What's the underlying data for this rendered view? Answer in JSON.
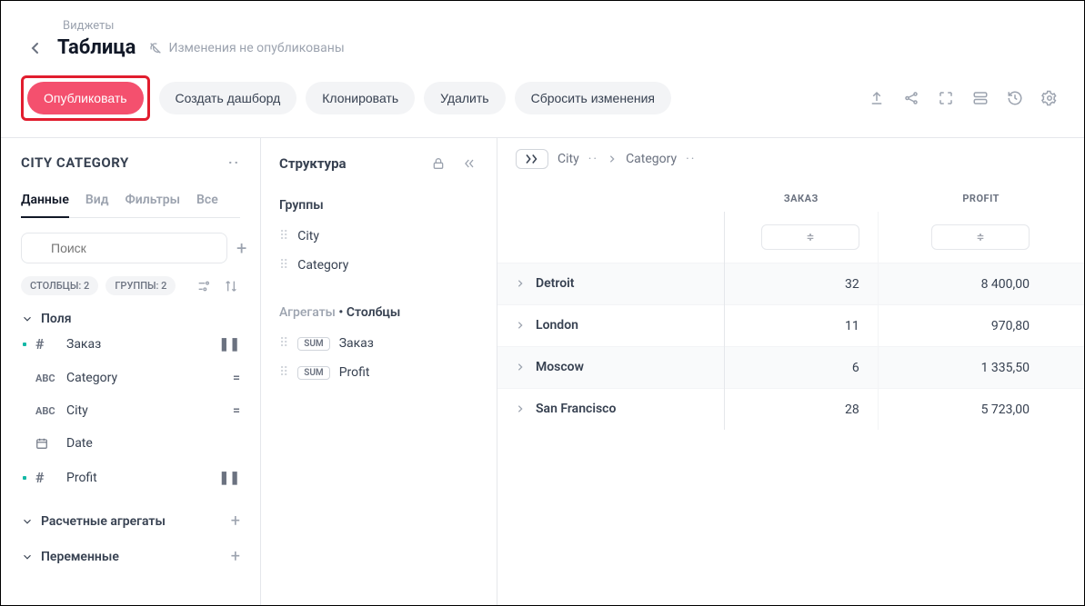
{
  "breadcrumb": "Виджеты",
  "title": "Таблица",
  "status": "Изменения не опубликованы",
  "actions": {
    "publish": "Опубликовать",
    "create_dashboard": "Создать дашборд",
    "clone": "Клонировать",
    "delete": "Удалить",
    "reset": "Сбросить изменения"
  },
  "left": {
    "title": "CITY CATEGORY",
    "tabs": {
      "data": "Данные",
      "view": "Вид",
      "filters": "Фильтры",
      "all": "Все"
    },
    "search_placeholder": "Поиск",
    "badge_cols": "СТОЛБЦЫ: 2",
    "badge_groups": "ГРУППЫ: 2",
    "section_fields": "Поля",
    "section_aggregates": "Расчетные агрегаты",
    "section_variables": "Переменные",
    "fields": [
      {
        "marker": true,
        "type": "#",
        "name": "Заказ",
        "action": "pause"
      },
      {
        "marker": false,
        "type": "ABC",
        "name": "Category",
        "action": "="
      },
      {
        "marker": false,
        "type": "ABC",
        "name": "City",
        "action": "="
      },
      {
        "marker": false,
        "type": "cal",
        "name": "Date",
        "action": ""
      },
      {
        "marker": true,
        "type": "#",
        "name": "Profit",
        "action": "pause"
      }
    ]
  },
  "structure": {
    "title": "Структура",
    "groups_label": "Группы",
    "groups": [
      "City",
      "Category"
    ],
    "aggregates_label": "Агрегаты",
    "columns_label": "Столбцы",
    "aggregates": [
      {
        "tag": "SUM",
        "name": "Заказ"
      },
      {
        "tag": "SUM",
        "name": "Profit"
      }
    ]
  },
  "data": {
    "crumbs": {
      "city": "City",
      "category": "Category"
    },
    "headers": {
      "order": "ЗАКАЗ",
      "profit": "PROFIT"
    },
    "rows": [
      {
        "name": "Detroit",
        "order": "32",
        "profit": "8 400,00"
      },
      {
        "name": "London",
        "order": "11",
        "profit": "970,80"
      },
      {
        "name": "Moscow",
        "order": "6",
        "profit": "1 335,50"
      },
      {
        "name": "San Francisco",
        "order": "28",
        "profit": "5 723,00"
      }
    ]
  }
}
